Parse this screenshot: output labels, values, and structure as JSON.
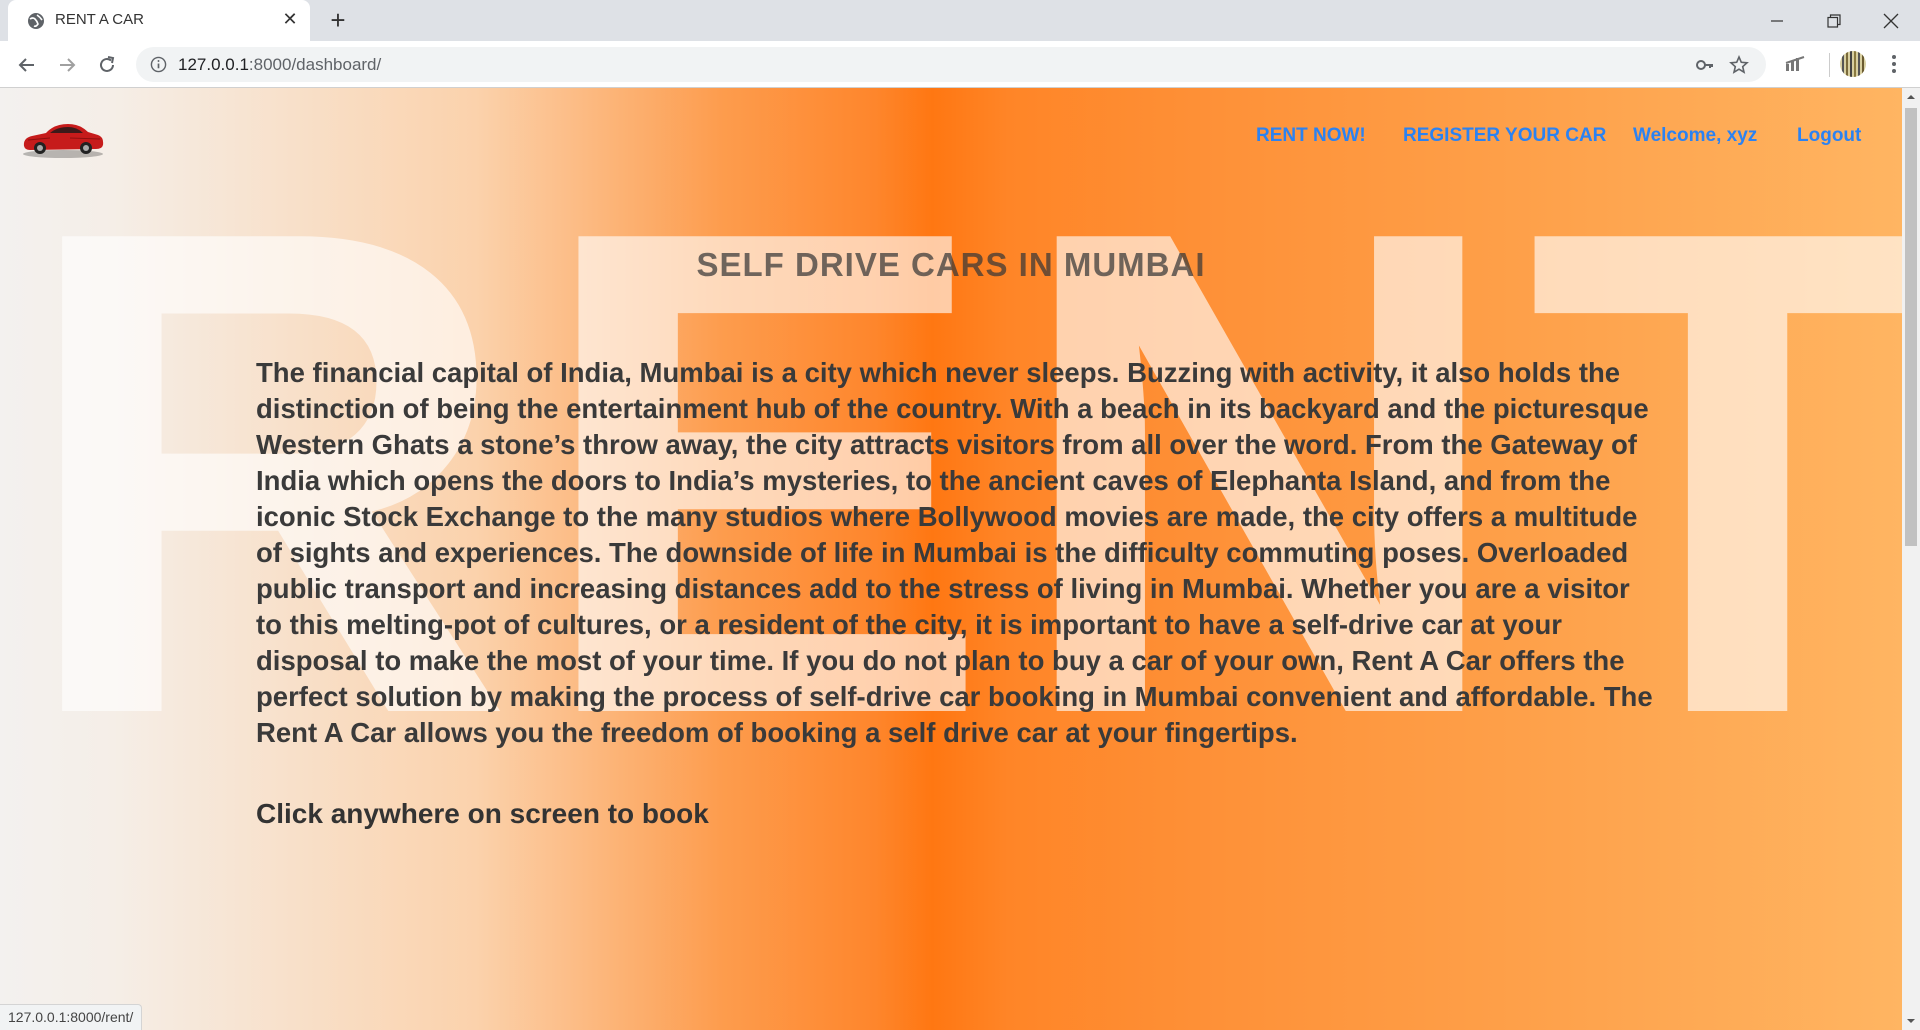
{
  "browser": {
    "tab_title": "RENT A CAR",
    "url_host": "127.0.0.1",
    "url_path": ":8000/dashboard/",
    "status_url": "127.0.0.1:8000/rent/"
  },
  "icons": {
    "favicon": "globe-icon",
    "close_tab": "close-icon",
    "new_tab": "plus-icon",
    "back": "arrow-left-icon",
    "forward": "arrow-right-icon",
    "reload": "reload-icon",
    "site_info": "info-icon",
    "key": "key-icon",
    "bookmark": "star-icon",
    "extension": "extension-icon",
    "profile": "avatar-icon",
    "menu": "kebab-menu-icon"
  },
  "page": {
    "background_word": "RENT",
    "nav": {
      "rent_now": "RENT NOW!",
      "register_car": "REGISTER YOUR CAR",
      "welcome": "Welcome, xyz",
      "logout": "Logout"
    },
    "heading": "SELF DRIVE CARS IN MUMBAI",
    "paragraph": "The financial capital of India, Mumbai is a city which never sleeps. Buzzing with activity, it also holds the distinction of being the entertainment hub of the country. With a beach in its backyard and the picturesque Western Ghats a stone’s throw away, the city attracts visitors from all over the word. From the Gateway of India which opens the doors to India’s mysteries, to the ancient caves of Elephanta Island, and from the iconic Stock Exchange to the many studios where Bollywood movies are made, the city offers a multitude of sights and experiences. The downside of life in Mumbai is the difficulty commuting poses. Overloaded public transport and increasing distances add to the stress of living in Mumbai. Whether you are a visitor to this melting-pot of cultures, or a resident of the city, it is important to have a self-drive car at your disposal to make the most of your time. If you do not plan to buy a car of your own, Rent A Car offers the perfect solution by making the process of self-drive car booking in Mumbai convenient and affordable. The Rent A Car allows you the freedom of booking a self drive car at your fingertips.",
    "cta": "Click anywhere on screen to book"
  },
  "colors": {
    "nav_link": "#2b82f2",
    "gradient_center": "#ff7712",
    "gradient_right": "#ffb562",
    "gradient_left": "#f3f1ef"
  }
}
